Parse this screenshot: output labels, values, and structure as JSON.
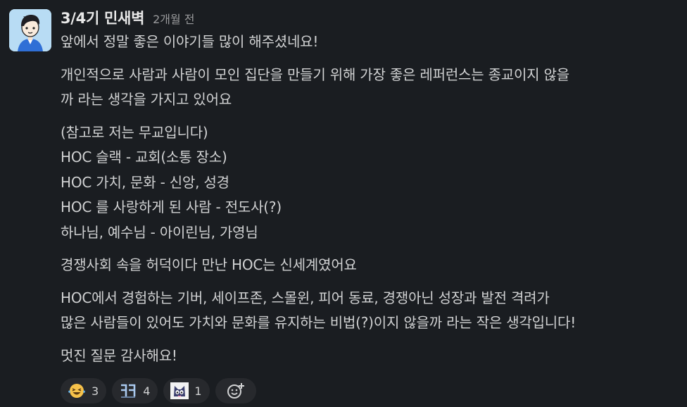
{
  "message": {
    "author": "3/4기 민새벽",
    "timestamp": "2개월 전",
    "paragraphs": [
      {
        "lines": [
          "앞에서 정말 좋은 이야기들 많이 해주셨네요!"
        ]
      },
      {
        "lines": [
          "개인적으로 사람과 사람이 모인 집단을 만들기 위해 가장 좋은 레퍼런스는 종교이지 않을",
          "까 라는 생각을 가지고 있어요"
        ]
      },
      {
        "lines": [
          "(참고로 저는 무교입니다)",
          "HOC 슬랙 - 교회(소통 장소)",
          "HOC 가치, 문화 - 신앙, 성경",
          "HOC 를 사랑하게 된 사람 - 전도사(?)",
          "하나님, 예수님 - 아이린님, 가영님"
        ]
      },
      {
        "lines": [
          "경쟁사회 속을 허덕이다 만난 HOC는 신세계였어요"
        ]
      },
      {
        "lines": [
          "HOC에서 경험하는 기버, 세이프존, 스몰윈, 피어 동료, 경쟁아닌 성장과 발전 격려가",
          "많은 사람들이 있어도 가치와 문화를 유지하는 비법(?)이지 않을까 라는 작은 생각입니다!"
        ]
      },
      {
        "lines": [
          "멋진 질문 감사해요!"
        ]
      }
    ]
  },
  "reactions": [
    {
      "icon": "laughing-tears-emoji-icon",
      "count": "3"
    },
    {
      "icon": "kkk-text-emoji-icon",
      "count": "4"
    },
    {
      "icon": "cat-character-emoji-icon",
      "count": "1"
    }
  ],
  "add_reaction_icon": "add-reaction-icon",
  "colors": {
    "background": "#1a1d21",
    "text": "#d1d2d3",
    "muted": "#9a9b9d",
    "reaction_bg": "#27292d"
  }
}
